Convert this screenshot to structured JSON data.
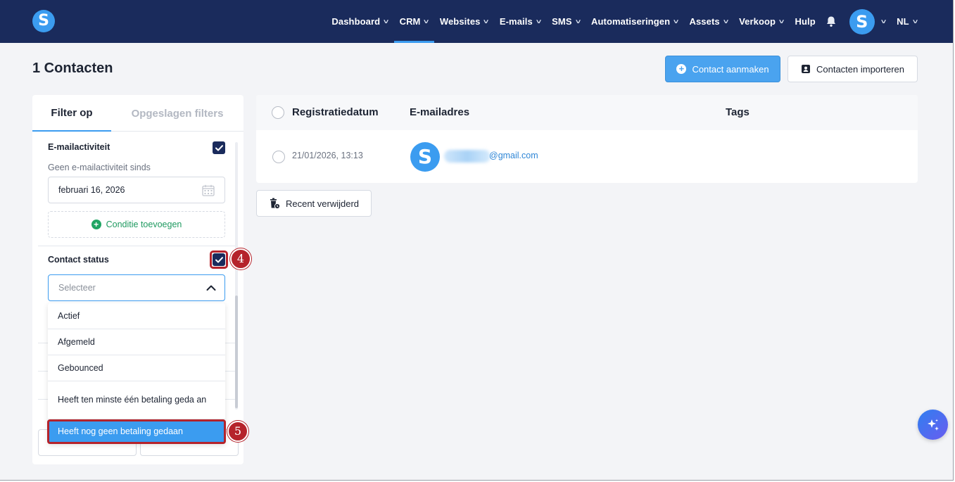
{
  "app": {
    "logo_letter": "S"
  },
  "nav": {
    "items": [
      {
        "label": "Dashboard",
        "has_dropdown": true
      },
      {
        "label": "CRM",
        "has_dropdown": true,
        "active": true
      },
      {
        "label": "Websites",
        "has_dropdown": true
      },
      {
        "label": "E-mails",
        "has_dropdown": true
      },
      {
        "label": "SMS",
        "has_dropdown": true
      },
      {
        "label": "Automatiseringen",
        "has_dropdown": true
      },
      {
        "label": "Assets",
        "has_dropdown": true
      },
      {
        "label": "Verkoop",
        "has_dropdown": true
      },
      {
        "label": "Hulp",
        "has_dropdown": false
      }
    ],
    "bell_icon": "bell-icon",
    "avatar_letter": "S",
    "language": "NL"
  },
  "page": {
    "title": "1 Contacten",
    "create_button": "Contact aanmaken",
    "import_button": "Contacten importeren"
  },
  "filters": {
    "tab_active": "Filter op",
    "tab_saved": "Opgeslagen filters",
    "email_activity": {
      "title": "E-mailactiviteit",
      "checked": true,
      "sub_label": "Geen e-mailactiviteit sinds",
      "date_value": "februari 16, 2026",
      "add_condition": "Conditie toevoegen"
    },
    "contact_status": {
      "title": "Contact status",
      "checked": true,
      "placeholder": "Selecteer",
      "options": [
        "Actief",
        "Afgemeld",
        "Gebounced",
        "Heeft ten minste één betaling geda an",
        "Heeft nog geen betaling gedaan"
      ],
      "highlighted_option": "Heeft nog geen betaling gedaan"
    }
  },
  "steps": {
    "step4": "4",
    "step5": "5"
  },
  "table": {
    "columns": [
      "Registratiedatum",
      "E-mailadres",
      "Tags"
    ],
    "rows": [
      {
        "date": "21/01/2026, 13:13",
        "avatar_letter": "S",
        "email_visible": "@gmail.com",
        "tags": ""
      }
    ]
  },
  "recent_deleted_button": "Recent verwijderd",
  "colors": {
    "nav_bg": "#1a2b5c",
    "accent": "#3b9cf0",
    "step_marker": "#b5232b",
    "success": "#1fa563"
  }
}
